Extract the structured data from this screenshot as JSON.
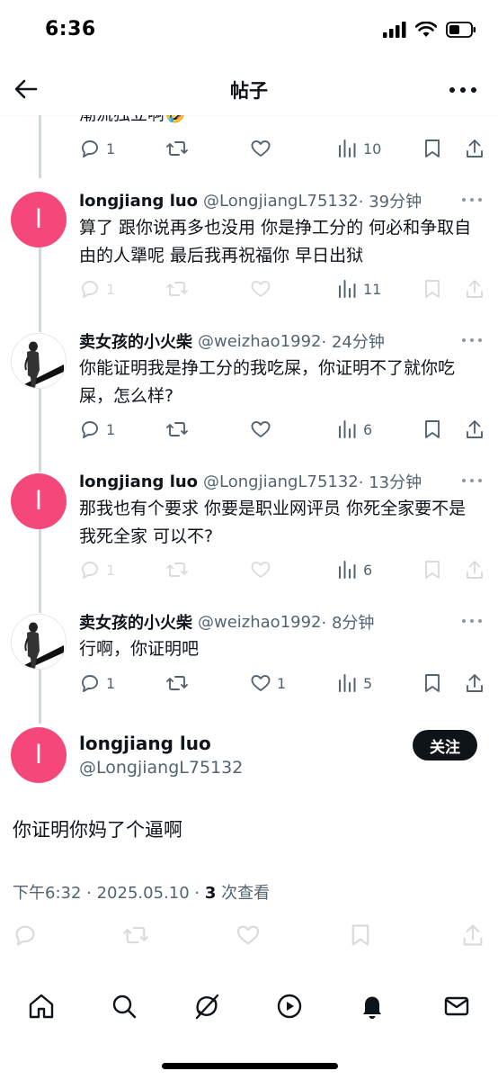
{
  "status_bar": {
    "time": "6:36"
  },
  "header": {
    "title": "帖子"
  },
  "partial_tweet": {
    "text_fragment": "潮流独立啊🤣",
    "replies": "1",
    "views": "10"
  },
  "replies": [
    {
      "name": "longjiang luo",
      "handle": "@LongjiangL75132",
      "time": "· 39分钟",
      "avatar_letter": "l",
      "text": "算了 跟你说再多也没用 你是挣工分的 何必和争取自由的人犟呢 最后我再祝福你 早日出狱",
      "replies": "1",
      "likes": "",
      "views": "11"
    },
    {
      "name": "卖女孩的小火柴",
      "handle": "@weizhao1992",
      "time": "· 24分钟",
      "text": "你能证明我是挣工分的我吃屎，你证明不了就你吃屎，怎么样?",
      "replies": "1",
      "likes": "",
      "views": "6"
    },
    {
      "name": "longjiang luo",
      "handle": "@LongjiangL75132",
      "time": "· 13分钟",
      "avatar_letter": "l",
      "text": "那我也有个要求 你要是职业网评员 你死全家要不是 我死全家 可以不?",
      "replies": "1",
      "likes": "",
      "views": "6"
    },
    {
      "name": "卖女孩的小火柴",
      "handle": "@weizhao1992",
      "time": "· 8分钟",
      "text": "行啊，你证明吧",
      "replies": "1",
      "likes": "1",
      "views": "5"
    }
  ],
  "main_tweet": {
    "name": "longjiang luo",
    "handle": "@LongjiangL75132",
    "avatar_letter": "l",
    "follow_label": "关注",
    "text": "你证明你妈了个逼啊",
    "meta_prefix": "下午6:32 · 2025.05.10 · ",
    "view_count": "3",
    "view_suffix": " 次查看"
  },
  "colors": {
    "accent_pink": "#f4487a",
    "secondary_text": "#536471",
    "thread_line": "#cfd9de"
  },
  "icons": [
    "back-arrow-icon",
    "more-icon",
    "reply-icon",
    "retweet-icon",
    "like-icon",
    "views-icon",
    "bookmark-icon",
    "share-icon",
    "home-icon",
    "search-icon",
    "grok-icon",
    "video-icon",
    "notifications-icon",
    "messages-icon"
  ]
}
